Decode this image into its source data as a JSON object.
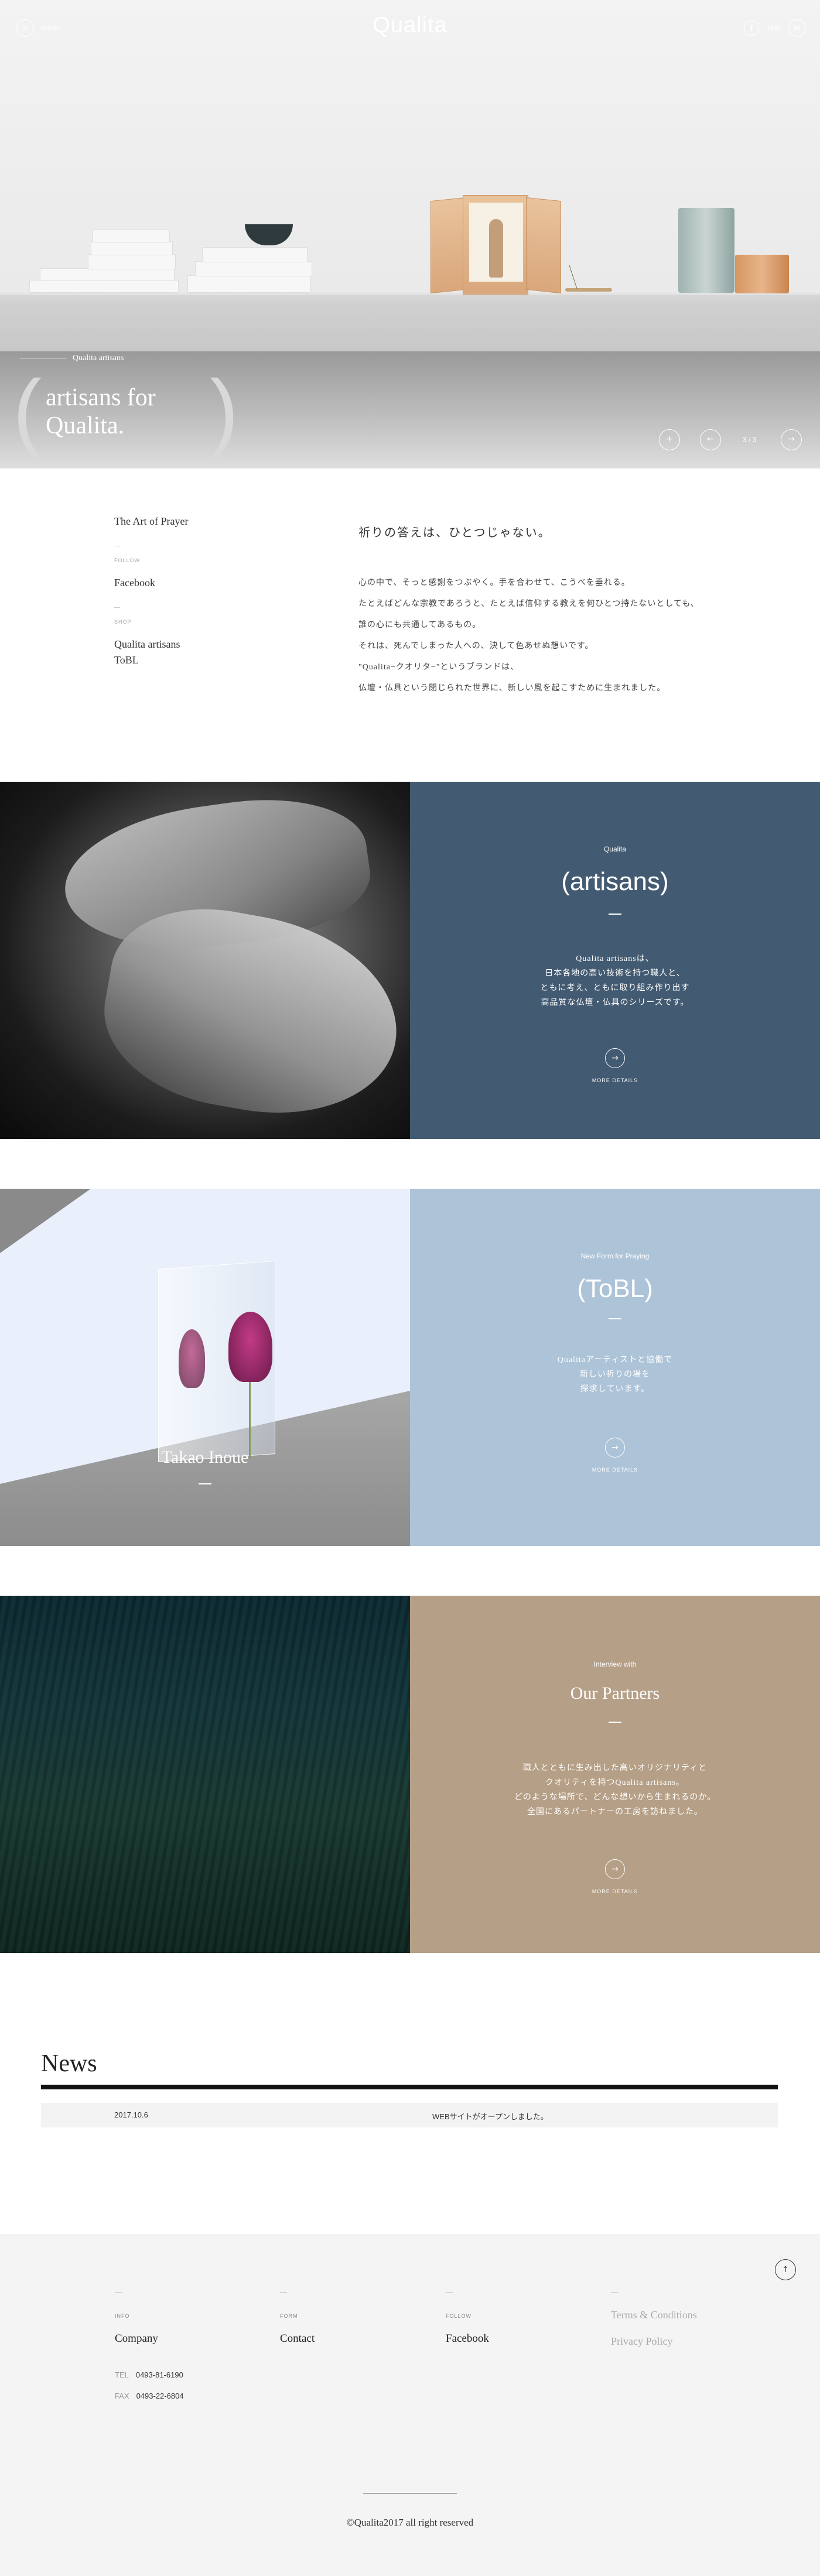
{
  "header": {
    "logo": "Qualita",
    "menu_label": "Menu",
    "facebook_icon_glyph": "f",
    "mail_label": "Mail",
    "mail_icon_glyph": "✉"
  },
  "hero": {
    "tag": "Qualita artisans",
    "title_line1": "artisans for",
    "title_line2": "Qualita.",
    "bracket_left": "(",
    "bracket_right": ")",
    "page_indicator": "3 / 3",
    "icons": [
      "plus-icon",
      "arrow-left-icon",
      "arrow-right-icon"
    ]
  },
  "intro": {
    "nav": {
      "link1": "The Art of Prayer",
      "cat1": "FOLLOW",
      "link2": "Facebook",
      "cat2": "SHOP",
      "link3a": "Qualita artisans",
      "link3b": "ToBL"
    },
    "heading": "祈りの答えは、ひとつじゃない。",
    "lines": [
      "心の中で、そっと感謝をつぶやく。手を合わせて、こうべを垂れる。",
      "たとえばどんな宗教であろうと、たとえば信仰する教えを何ひとつ持たないとしても、",
      "誰の心にも共通してあるもの。",
      "それは、死んでしまった人への、決して色あせぬ想いです。",
      "\"Qualita−クオリタ−\"というブランドは、",
      "仏壇・仏具という閉じられた世界に、新しい風を起こすために生まれました。"
    ]
  },
  "artisans": {
    "small": "Qualita",
    "title": "(artisans)",
    "body": [
      "Qualita artisansは、",
      "日本各地の高い技術を持つ職人と、",
      "ともに考え、ともに取り組み作り出す",
      "高品質な仏壇・仏具のシリーズです。"
    ],
    "more": "MORE DETAILS",
    "color": "#435b72"
  },
  "tobl": {
    "small": "New Form for Praying",
    "title": "(ToBL)",
    "photo_caption": "Takao Inoue",
    "body": [
      "Qualitaアーティストと協働で",
      "新しい祈りの場を",
      "探求しています。"
    ],
    "more": "MORE DETAILS",
    "color": "#adc3d8"
  },
  "partners": {
    "small": "Interview with",
    "title": "Our Partners",
    "body": [
      "職人とともに生み出した高いオリジナリティと",
      "クオリティを持つQualita artisans。",
      "どのような場所で、どんな想いから生まれるのか。",
      "全国にあるパートナーの工房を訪ねました。"
    ],
    "more": "MORE DETAILS",
    "color": "#b59f86"
  },
  "news": {
    "title": "News",
    "items": [
      {
        "date": "2017.10.6",
        "text": "WEBサイトがオープンしました。"
      }
    ]
  },
  "footer": {
    "col1_cat": "INFO",
    "col1_link": "Company",
    "col2_cat": "FORM",
    "col2_link": "Contact",
    "col3_cat": "FOLLOW",
    "col3_link": "Facebook",
    "terms": "Terms & Conditions",
    "privacy": "Privacy Policy",
    "tel_label": "TEL",
    "tel": "0493-81-6190",
    "fax_label": "FAX",
    "fax": "0493-22-6804",
    "copyright": "©Qualita2017 all right reserved",
    "page_top_icon_glyph": "↑"
  }
}
